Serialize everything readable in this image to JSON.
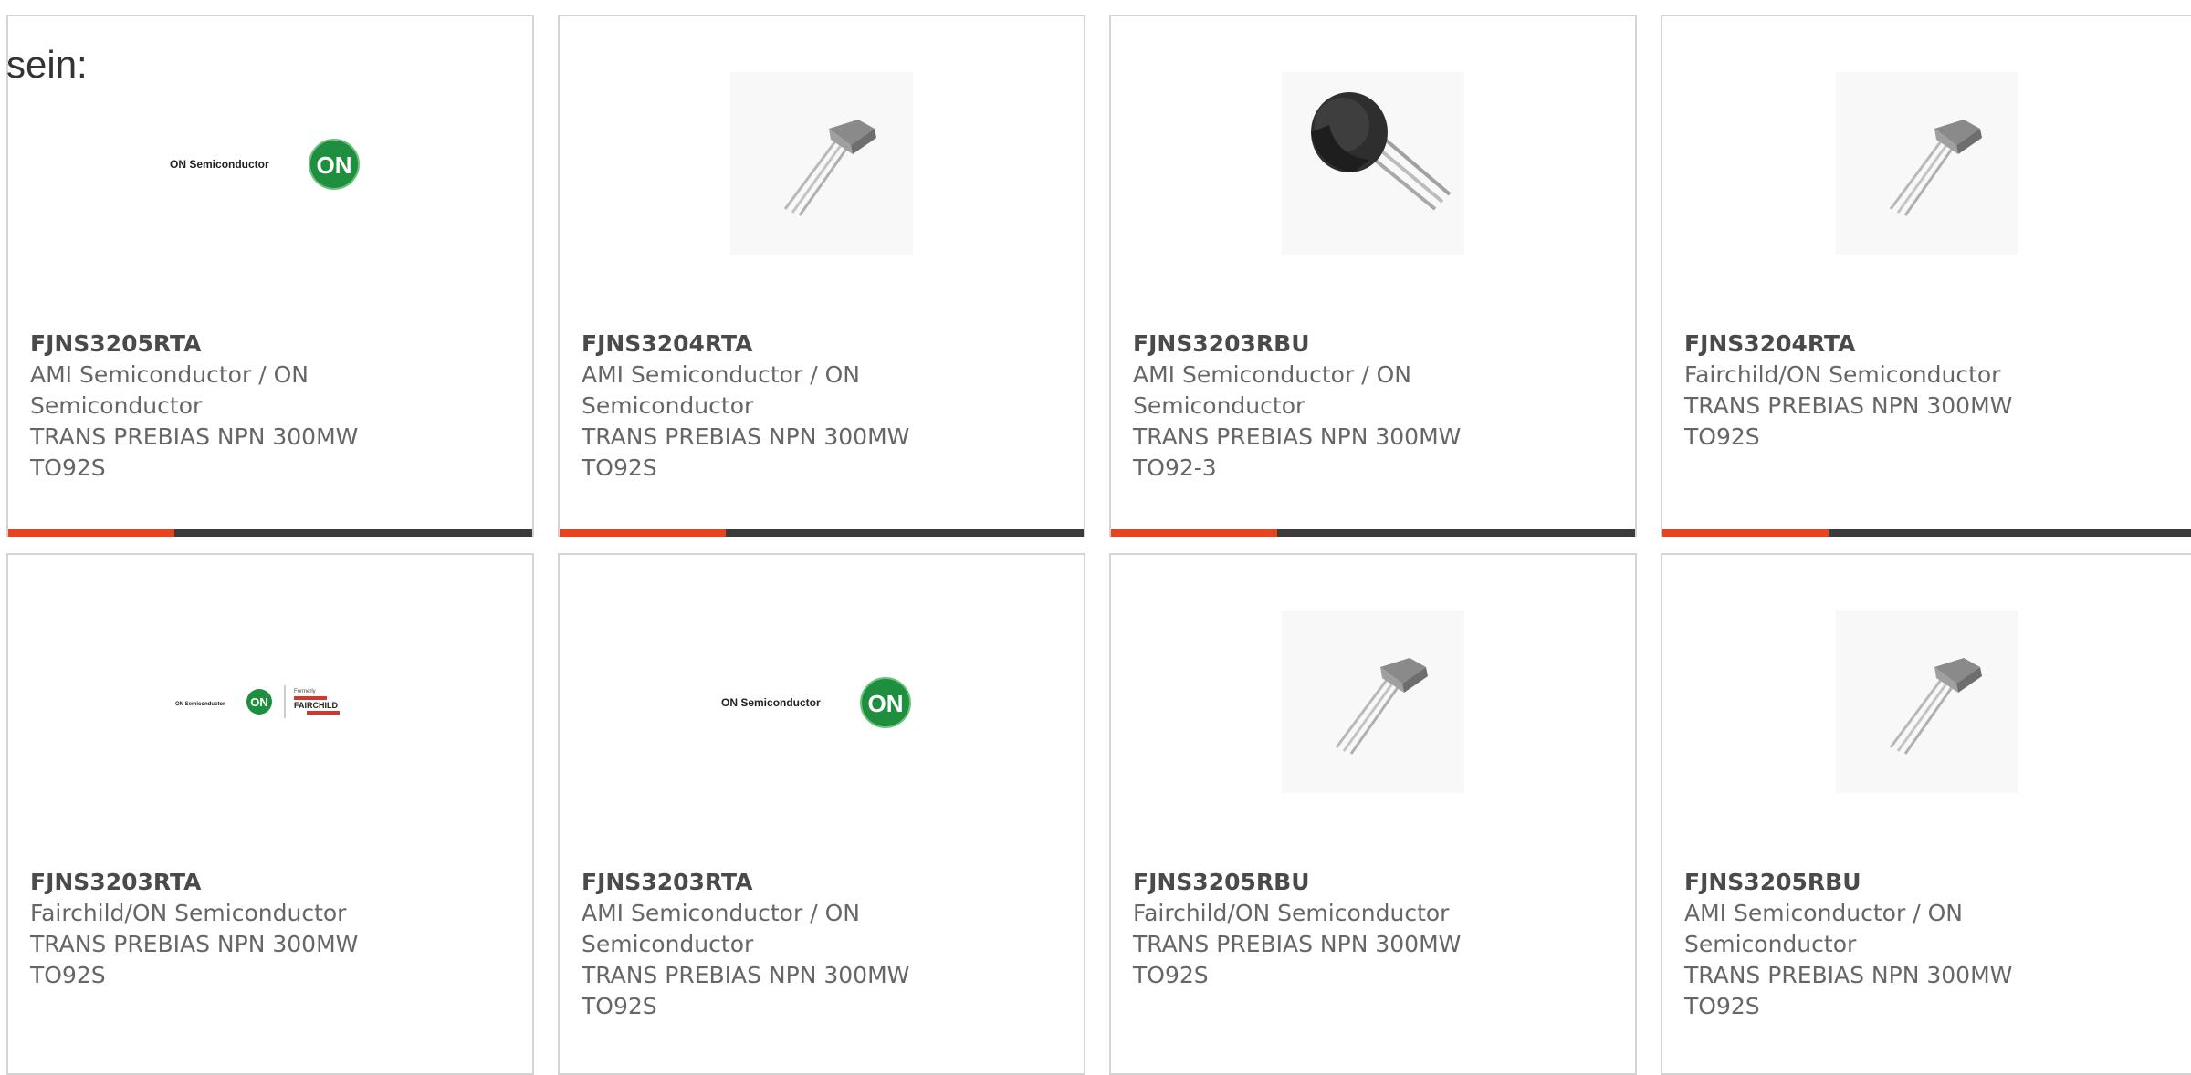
{
  "intro": "sein:",
  "colors": {
    "accent": "#e8431f",
    "bar": "#3b3b3b",
    "border": "#d4d4d4",
    "on_green": "#1e8f3e",
    "fairchild_red": "#d4352c"
  },
  "cards": [
    {
      "part": "FJNS3205RTA",
      "manufacturer": "AMI Semiconductor / ON Semiconductor",
      "description": "TRANS PREBIAS NPN 300MW TO92S",
      "image": "on-semiconductor-logo"
    },
    {
      "part": "FJNS3204RTA",
      "manufacturer": "AMI Semiconductor / ON Semiconductor",
      "description": "TRANS PREBIAS NPN 300MW TO92S",
      "image": "to92s-transistor-photo"
    },
    {
      "part": "FJNS3203RBU",
      "manufacturer": "AMI Semiconductor / ON Semiconductor",
      "description": "TRANS PREBIAS NPN 300MW TO92-3",
      "image": "to92-transistor-photo"
    },
    {
      "part": "FJNS3204RTA",
      "manufacturer": "Fairchild/ON Semiconductor",
      "description": "TRANS PREBIAS NPN 300MW TO92S",
      "image": "to92s-transistor-photo"
    },
    {
      "part": "FJNS3203RTA",
      "manufacturer": "Fairchild/ON Semiconductor",
      "description": "TRANS PREBIAS NPN 300MW TO92S",
      "image": "on-fairchild-logo"
    },
    {
      "part": "FJNS3203RTA",
      "manufacturer": "AMI Semiconductor / ON Semiconductor",
      "description": "TRANS PREBIAS NPN 300MW TO92S",
      "image": "on-semiconductor-logo"
    },
    {
      "part": "FJNS3205RBU",
      "manufacturer": "Fairchild/ON Semiconductor",
      "description": "TRANS PREBIAS NPN 300MW TO92S",
      "image": "to92s-transistor-photo"
    },
    {
      "part": "FJNS3205RBU",
      "manufacturer": "AMI Semiconductor / ON Semiconductor",
      "description": "TRANS PREBIAS NPN 300MW TO92S",
      "image": "to92s-transistor-photo"
    }
  ],
  "logos": {
    "on_semi_text": "ON Semiconductor",
    "on_badge": "ON",
    "formerly": "Formerly",
    "fairchild": "FAIRCHILD"
  }
}
